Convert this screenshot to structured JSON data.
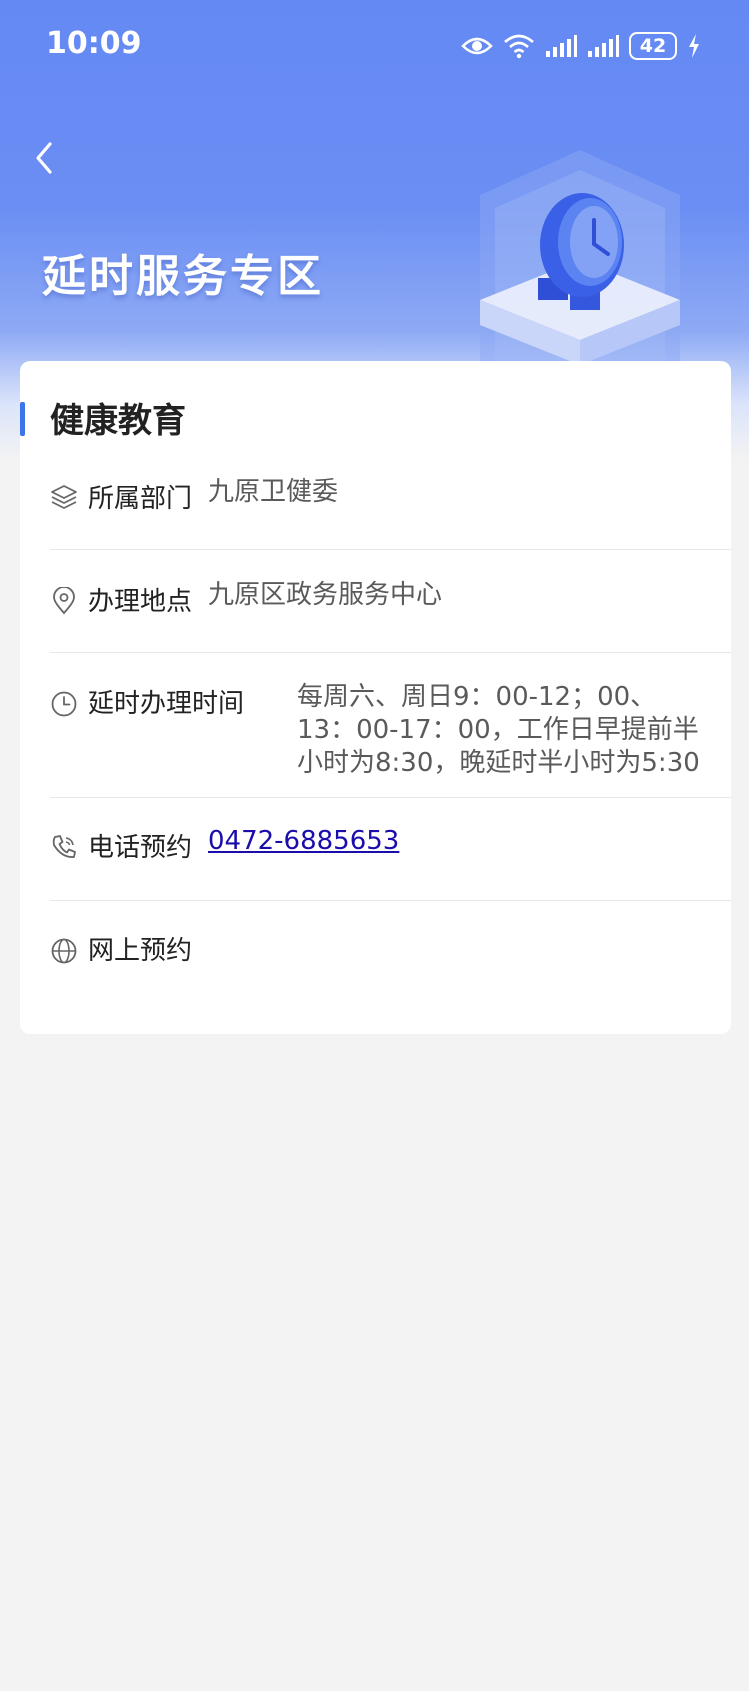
{
  "status_bar": {
    "time": "10:09",
    "battery": "42"
  },
  "header": {
    "title": "延时服务专区"
  },
  "card": {
    "title": "健康教育",
    "rows": [
      {
        "label": "所属部门",
        "value": "九原卫健委",
        "icon": "layers-icon"
      },
      {
        "label": "办理地点",
        "value": "九原区政务服务中心",
        "icon": "location-pin-icon"
      },
      {
        "label": "延时办理时间",
        "value_lines": [
          "每周六、周日9：00-12；00、",
          "13：00-17：00，工作日早提前半",
          "小时为8:30，晚延时半小时为5:30"
        ],
        "icon": "clock-icon"
      },
      {
        "label": "电话预约",
        "value": "0472-6885653",
        "icon": "phone-icon"
      },
      {
        "label": "网上预约",
        "value": "",
        "icon": "globe-icon"
      }
    ]
  },
  "colors": {
    "accent": "#3c74ea",
    "hero": "#6589f3",
    "link": "#1a0dab"
  }
}
